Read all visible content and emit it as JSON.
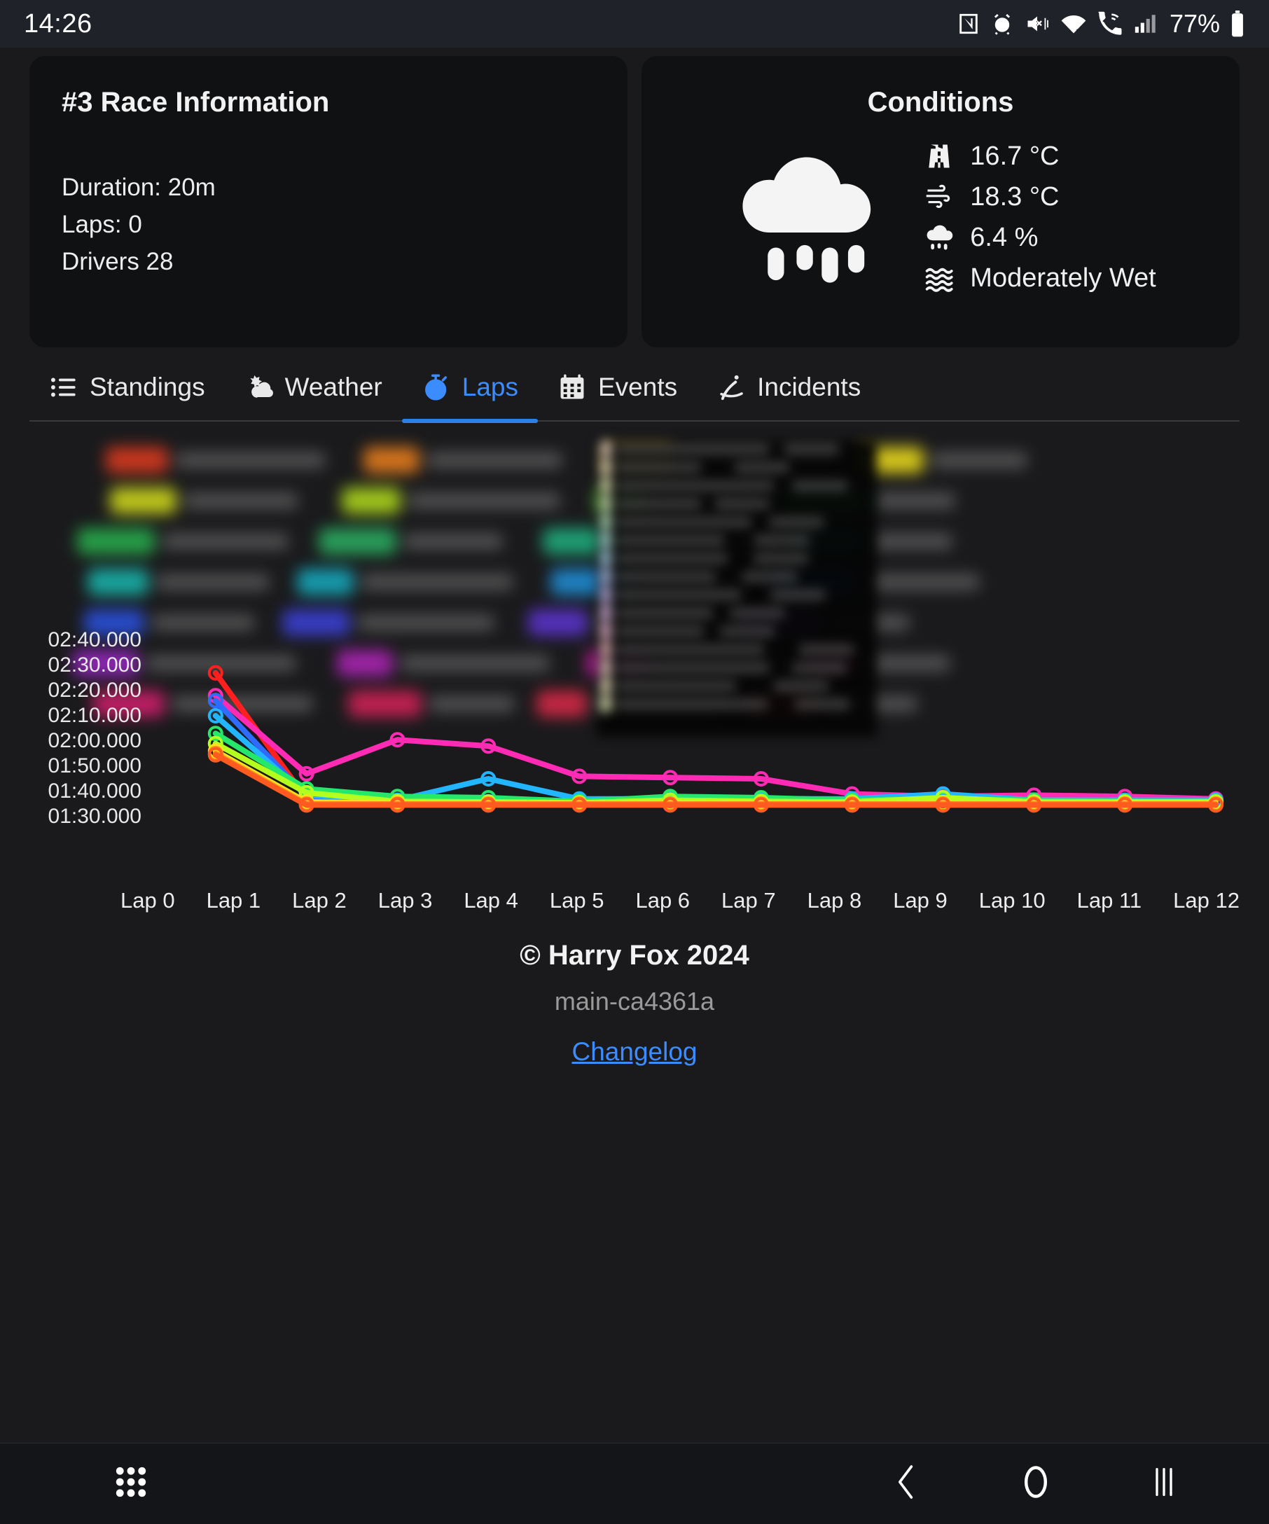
{
  "status_bar": {
    "time": "14:26",
    "battery_percent": "77%",
    "icons": [
      "nfc-icon",
      "alarm-icon",
      "mute-vibrate-icon",
      "wifi-icon",
      "wifi-calling-icon",
      "signal-icon",
      "battery-icon"
    ]
  },
  "race_card": {
    "title": "#3 Race Information",
    "lines": [
      "Duration: 20m",
      "Laps: 0",
      "Drivers 28"
    ]
  },
  "conditions_card": {
    "title": "Conditions",
    "weather_icon": "rain-cloud-icon",
    "metrics": [
      {
        "icon": "road-icon",
        "value": "16.7 °C"
      },
      {
        "icon": "wind-icon",
        "value": "18.3 °C"
      },
      {
        "icon": "rain-cloud-icon",
        "value": "6.4 %"
      },
      {
        "icon": "wetness-waves-icon",
        "value": "Moderately Wet"
      }
    ]
  },
  "tabs": [
    {
      "label": "Standings",
      "icon": "list-icon",
      "active": false
    },
    {
      "label": "Weather",
      "icon": "cloud-sun-icon",
      "active": false
    },
    {
      "label": "Laps",
      "icon": "stopwatch-icon",
      "active": true
    },
    {
      "label": "Events",
      "icon": "calendar-icon",
      "active": false
    },
    {
      "label": "Incidents",
      "icon": "spin-car-icon",
      "active": false
    }
  ],
  "footer": {
    "copyright": "© Harry Fox 2024",
    "build": "main-ca4361a",
    "changelog_label": "Changelog"
  },
  "nav_bar": {
    "items": [
      "apps-grid-icon",
      "back-icon",
      "home-icon",
      "recents-icon"
    ]
  },
  "chart_data": {
    "type": "line",
    "title": "",
    "xlabel": "",
    "ylabel": "",
    "grid": false,
    "legend_position": "top",
    "legend_blurred": true,
    "tooltip_blurred": true,
    "tooltip_sample_text": "01:42.910",
    "categories": [
      "Lap 0",
      "Lap 1",
      "Lap 2",
      "Lap 3",
      "Lap 4",
      "Lap 5",
      "Lap 6",
      "Lap 7",
      "Lap 8",
      "Lap 9",
      "Lap 10",
      "Lap 11",
      "Lap 12"
    ],
    "ytick_labels": [
      "02:40.000",
      "02:30.000",
      "02:20.000",
      "02:10.000",
      "02:00.000",
      "01:50.000",
      "01:40.000",
      "01:30.000"
    ],
    "ylim": [
      "01:30.000",
      "02:40.000"
    ],
    "ytick_seconds": [
      160,
      150,
      140,
      130,
      120,
      110,
      100,
      90
    ],
    "series": [
      {
        "name": "driver-1",
        "color": "#ff1f1f",
        "values": [
          null,
          152.0,
          102.0,
          100.5,
          100.2,
          100.0,
          100.0,
          100.0,
          100.0,
          100.0,
          100.0,
          100.0,
          100.0
        ]
      },
      {
        "name": "driver-2",
        "color": "#ff2bb4",
        "values": [
          null,
          143.0,
          112.0,
          125.5,
          123.0,
          111.0,
          110.5,
          110.0,
          104.0,
          103.0,
          103.5,
          103.0,
          102.0
        ]
      },
      {
        "name": "driver-3",
        "color": "#2f6bff",
        "values": [
          null,
          141.0,
          103.0,
          101.5,
          101.0,
          101.0,
          101.0,
          101.0,
          101.0,
          101.0,
          101.0,
          101.0,
          101.0
        ]
      },
      {
        "name": "driver-4",
        "color": "#21b6ff",
        "values": [
          null,
          135.0,
          103.5,
          101.5,
          110.0,
          102.0,
          102.0,
          102.0,
          102.0,
          104.0,
          101.5,
          101.5,
          101.5
        ]
      },
      {
        "name": "driver-5",
        "color": "#25e86b",
        "values": [
          null,
          128.0,
          106.0,
          103.0,
          102.5,
          101.0,
          103.0,
          102.5,
          101.5,
          102.0,
          101.5,
          101.0,
          101.0
        ]
      },
      {
        "name": "driver-6",
        "color": "#b5ff1f",
        "values": [
          null,
          124.0,
          104.5,
          101.0,
          100.8,
          100.5,
          101.5,
          101.0,
          100.8,
          102.5,
          100.8,
          100.8,
          100.8
        ]
      },
      {
        "name": "driver-7",
        "color": "#ffe01f",
        "values": [
          null,
          121.0,
          100.8,
          100.3,
          100.2,
          100.2,
          100.2,
          100.2,
          100.2,
          100.2,
          100.2,
          100.2,
          100.2
        ]
      },
      {
        "name": "driver-8",
        "color": "#ff8a1f",
        "values": [
          null,
          120.0,
          100.0,
          100.0,
          100.0,
          100.0,
          100.0,
          100.0,
          100.0,
          100.0,
          100.0,
          100.0,
          100.0
        ]
      },
      {
        "name": "driver-9",
        "color": "#ff5a1f",
        "values": [
          null,
          119.5,
          99.6,
          99.6,
          99.6,
          99.6,
          99.6,
          99.6,
          99.6,
          99.6,
          99.6,
          99.6,
          99.6
        ]
      }
    ]
  },
  "legend_chip_colors": [
    [
      "#d3391f",
      "#e07a1c",
      "#e0b81c",
      "#e2d21c"
    ],
    [
      "#c9d21c",
      "#a9d21c",
      "#62c93a",
      "#3fc96a"
    ],
    [
      "#27a84b",
      "#2aa85f",
      "#1fa87a",
      "#1f9f95"
    ],
    [
      "#19b0a8",
      "#16a5b8",
      "#1f8ad0",
      "#1f6ad8"
    ],
    [
      "#2a4fd8",
      "#3a3fd0",
      "#5a33c9",
      "#7a2ec4"
    ],
    [
      "#9428bd",
      "#a824b0",
      "#bf1f9e",
      "#c91f84"
    ],
    [
      "#c91f6a",
      "#cc2156",
      "#d32846",
      "#d63a3a"
    ]
  ],
  "tooltip_swatch_colors": [
    "#f0d8c8",
    "#f3e6c0",
    "#e9efb8",
    "#d7f0bc",
    "#c2eecb",
    "#b6e6df",
    "#b2d8f0",
    "#bcc8f2",
    "#ccbdf0",
    "#e1bbe8",
    "#f0bcd6",
    "#f2c0c0"
  ]
}
